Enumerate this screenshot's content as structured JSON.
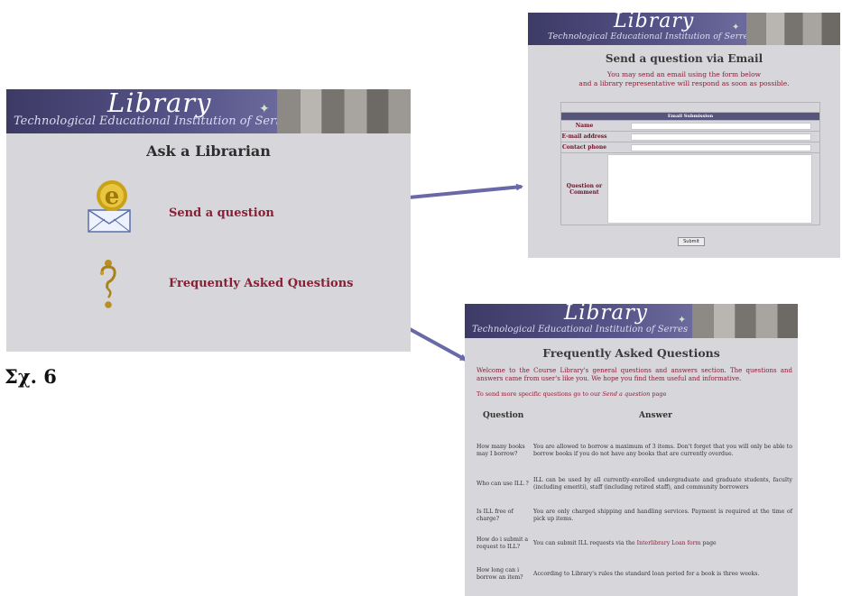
{
  "banner": {
    "title": "Library",
    "subtitle": "Technological Educational Institution of Serres"
  },
  "ask": {
    "heading": "Ask a Librarian",
    "send_link": "Send a question",
    "faq_link": "Frequently Asked Questions",
    "email_icon_glyph": "e"
  },
  "email_form": {
    "title": "Send a question via Email",
    "intro_line1": "You may send an email using the form below",
    "intro_line2": "and a library representative will respond as soon as possible.",
    "table_header": "Email Submission",
    "fields": {
      "name": "Name",
      "email": "E-mail address",
      "phone": "Contact phone",
      "question_line1": "Question or",
      "question_line2": "Comment"
    },
    "submit_label": "Submit"
  },
  "faq": {
    "title": "Frequently Asked Questions",
    "intro": "Welcome to the Course Library's general questions and answers section. The questions and answers came from user's like you. We hope you find them useful and informative.",
    "intro2_prefix": "To send more specific questions go to our ",
    "intro2_link": "Send a question",
    "intro2_suffix": " page",
    "col_question": "Question",
    "col_answer": "Answer",
    "rows": [
      {
        "q": "How many books may I borrow?",
        "a": "You are allowed to borrow a maximum of 3 items. Don't forget that you will only be able to borrow books if you do not have any books that are currently overdue."
      },
      {
        "q": "Who can use ILL ?",
        "a": "ILL can be used by all currently-enrolled undergraduate and graduate students, faculty (including emeriti), staff (including retired staff), and community borrowers"
      },
      {
        "q": "Is ILL free of charge?",
        "a": "You are only charged shipping and handling services. Payment is required at the time of pick up items."
      },
      {
        "q": "How do i submit a request to ILL?",
        "a_prefix": "You can submit ILL requests via the ",
        "a_link": "Interlibrary Loan form",
        "a_suffix": " page"
      },
      {
        "q": "How long can i borrow an item?",
        "a": "According to Library's rules the standard loan period for a book is three weeks."
      }
    ]
  },
  "caption": "Σχ. 6",
  "colors": {
    "banner": "#57548a",
    "panel": "#d7d6da",
    "link": "#8b1e37",
    "arrow": "#6a69a8"
  }
}
